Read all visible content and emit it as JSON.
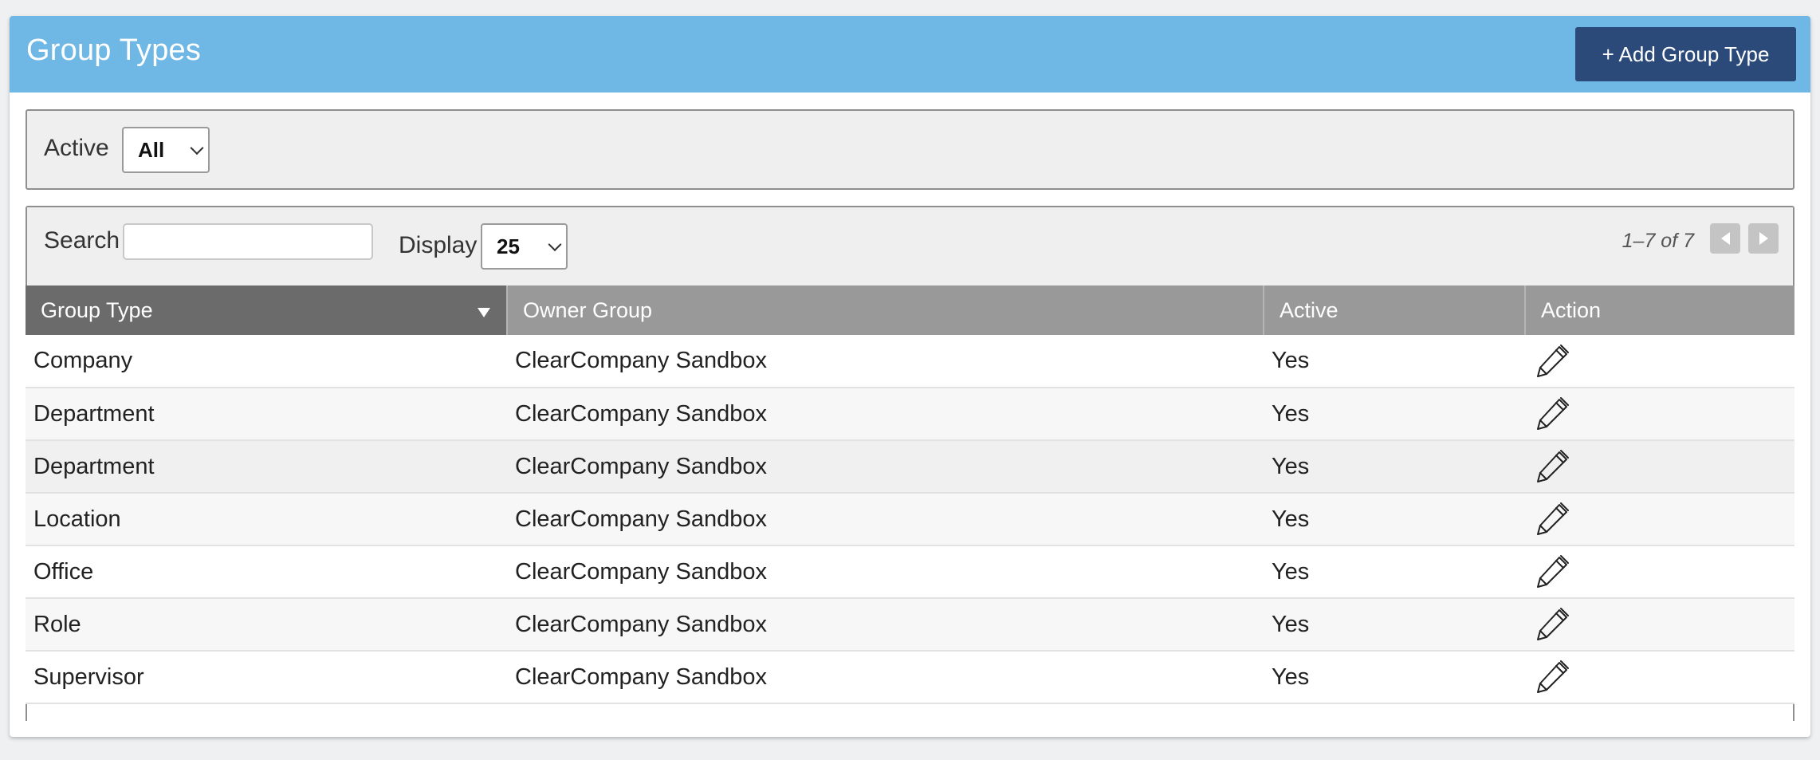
{
  "header": {
    "title": "Group Types",
    "add_button_label": "+ Add Group Type"
  },
  "filter": {
    "active_label": "Active",
    "active_value": "All"
  },
  "toolbar": {
    "search_label": "Search",
    "search_value": "",
    "display_label": "Display",
    "display_value": "25",
    "pager_text": "1–7 of 7"
  },
  "table": {
    "columns": [
      "Group Type",
      "Owner Group",
      "Active",
      "Action"
    ],
    "sorted_column": "Group Type",
    "rows": [
      {
        "group_type": "Company",
        "owner_group": "ClearCompany Sandbox",
        "active": "Yes",
        "action_icon": "pencil-icon"
      },
      {
        "group_type": "Department",
        "owner_group": "ClearCompany Sandbox",
        "active": "Yes",
        "action_icon": "pencil-icon"
      },
      {
        "group_type": "Department",
        "owner_group": "ClearCompany Sandbox",
        "active": "Yes",
        "action_icon": "pencil-icon"
      },
      {
        "group_type": "Location",
        "owner_group": "ClearCompany Sandbox",
        "active": "Yes",
        "action_icon": "pencil-icon"
      },
      {
        "group_type": "Office",
        "owner_group": "ClearCompany Sandbox",
        "active": "Yes",
        "action_icon": "pencil-icon"
      },
      {
        "group_type": "Role",
        "owner_group": "ClearCompany Sandbox",
        "active": "Yes",
        "action_icon": "pencil-icon"
      },
      {
        "group_type": "Supervisor",
        "owner_group": "ClearCompany Sandbox",
        "active": "Yes",
        "action_icon": "pencil-icon"
      }
    ]
  },
  "colors": {
    "header_bg": "#6fb7e4",
    "add_button_bg": "#2b4a7a",
    "table_header_bg": "#999999",
    "sorted_header_bg": "#6b6b6b"
  }
}
